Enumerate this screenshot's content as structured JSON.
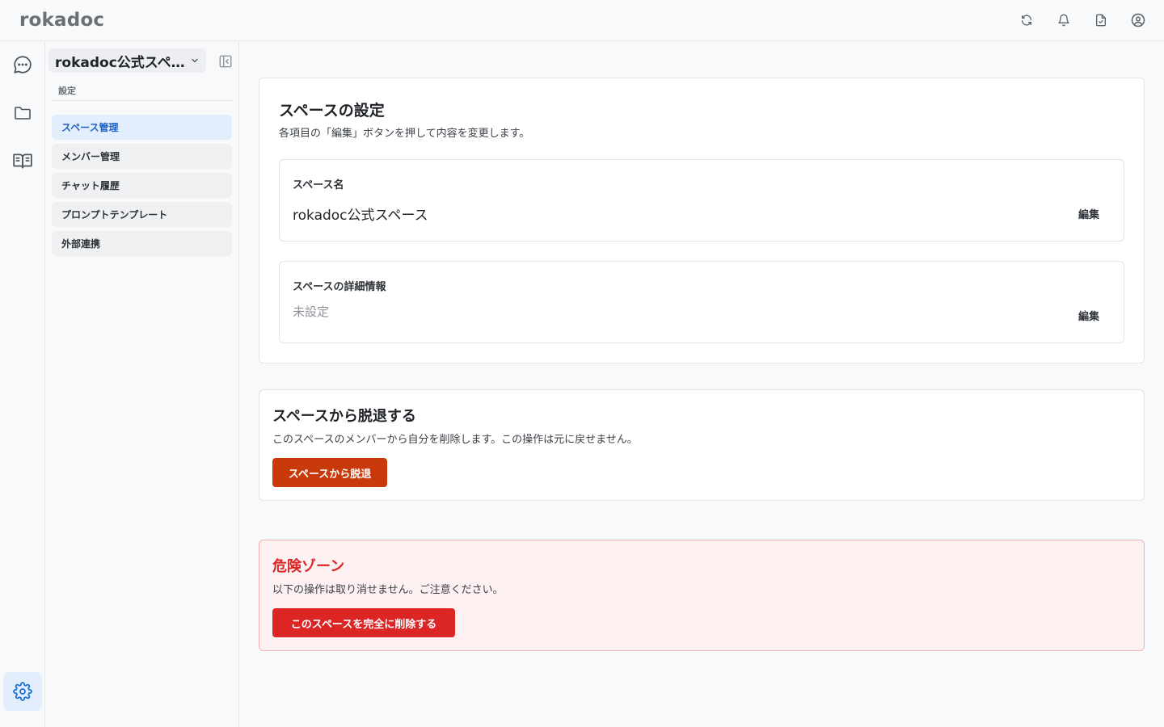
{
  "app": {
    "brand": "rokadoc"
  },
  "topbar": {
    "icons": [
      "refresh-icon",
      "bell-icon",
      "document-icon",
      "user-icon"
    ]
  },
  "rail": {
    "items": [
      "chat-icon",
      "folder-icon",
      "book-icon"
    ],
    "settings": "gear-icon"
  },
  "sidebar": {
    "space_name": "rokadoc公式スペ…",
    "section_label": "設定",
    "items": [
      {
        "label": "スペース管理",
        "active": true
      },
      {
        "label": "メンバー管理",
        "active": false
      },
      {
        "label": "チャット履歴",
        "active": false
      },
      {
        "label": "プロンプトテンプレート",
        "active": false
      },
      {
        "label": "外部連携",
        "active": false
      }
    ]
  },
  "settings": {
    "title": "スペースの設定",
    "description": "各項目の「編集」ボタンを押して内容を変更します。",
    "fields": [
      {
        "label": "スペース名",
        "value": "rokadoc公式スペース",
        "edit": "編集"
      },
      {
        "label": "スペースの詳細情報",
        "value": "未設定",
        "edit": "編集"
      }
    ]
  },
  "leave": {
    "title": "スペースから脱退する",
    "description": "このスペースのメンバーから自分を削除します。この操作は元に戻せません。",
    "button": "スペースから脱退"
  },
  "danger": {
    "title": "危険ゾーン",
    "description": "以下の操作は取り消せません。ご注意ください。",
    "button": "このスペースを完全に削除する"
  },
  "colors": {
    "accent": "#1d62c4",
    "leave_button": "#c83a0a",
    "danger": "#dc2626",
    "danger_bg": "#fdf1f1"
  }
}
